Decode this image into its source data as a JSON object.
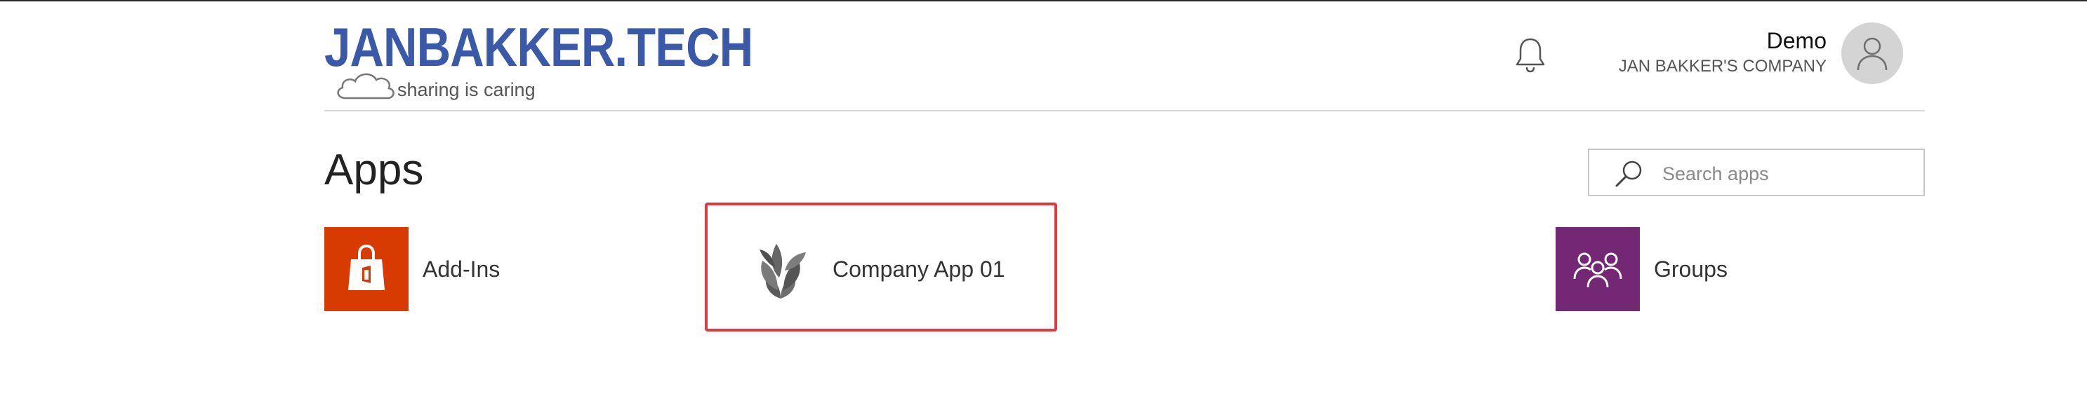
{
  "header": {
    "logo_title": "JANBAKKER.TECH",
    "logo_tagline": "sharing is caring",
    "notifications_icon": "bell-icon",
    "user_name": "Demo",
    "company_name": "JAN BAKKER'S COMPANY",
    "avatar_icon": "person-icon"
  },
  "page": {
    "title": "Apps",
    "search": {
      "placeholder": "Search apps",
      "value": "",
      "icon": "search-icon"
    }
  },
  "apps": [
    {
      "label": "Add-Ins",
      "icon": "office-store-icon",
      "color": "#d83b01"
    },
    {
      "label": "Company App 01",
      "icon": "leaf-plant-icon",
      "color": "#666666",
      "highlighted": true
    },
    {
      "label": "Groups",
      "icon": "groups-icon",
      "color": "#742774"
    }
  ],
  "colors": {
    "logo": "#3a59a8",
    "highlight": "#e03a3e"
  }
}
